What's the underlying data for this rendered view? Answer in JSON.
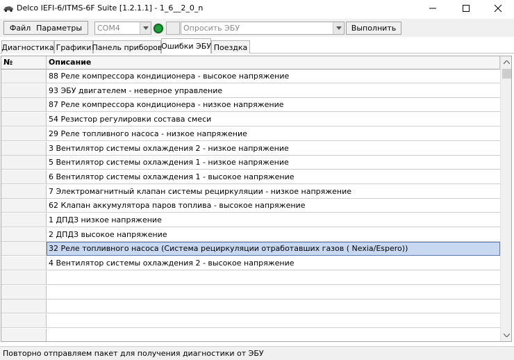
{
  "window": {
    "title": "Delco IEFI-6/ITMS-6F Suite [1.2.1.1] - 1_6__2_0_n",
    "controls": {
      "minimize": "—",
      "maximize": "☐",
      "close": "✕"
    }
  },
  "toolbar": {
    "menu_file": "Файл",
    "menu_params": "Параметры",
    "port_value": "COM4",
    "request_value": "Опросить ЭБУ",
    "execute_label": "Выполнить",
    "status_led_color": "#1f9e3a"
  },
  "tabs": [
    {
      "label": "Диагностика",
      "active": false
    },
    {
      "label": "Графики",
      "active": false
    },
    {
      "label": "Панель приборов",
      "active": false
    },
    {
      "label": "Ошибки ЭБУ",
      "active": true
    },
    {
      "label": "Поездка",
      "active": false
    }
  ],
  "grid": {
    "columns": [
      "№",
      "Описание"
    ],
    "rows": [
      "88 Реле компрессора кондиционера - высокое напряжение",
      "93 ЭБУ двигателем - неверное управление",
      "87 Реле компрессора кондиционера - низкое напряжение",
      "54 Резистор регулировки состава смеси",
      "29 Реле топливного насоса - низкое напряжение",
      "3 Вентилятор системы охлаждения 2 - низкое напряжение",
      "5 Вентилятор системы охлаждения 1 - низкое напряжение",
      "6 Вентилятор системы охлаждения 1 - высокое напряжение",
      "7 Электромагнитный клапан системы рециркуляции - низкое напряжение",
      "62 Клапан аккумулятора паров топлива - высокое напряжение",
      "1 ДПДЗ низкое напряжение",
      "2 ДПДЗ высокое напряжение",
      "32 Реле топливного насоса (Система рециркуляции отработавших газов ( Nexia/Espero))",
      "4 Вентилятор системы охлаждения 2 - высокое напряжение",
      "",
      "",
      "",
      "",
      ""
    ],
    "selected_row": 12,
    "selection_color": "#c8d8f0"
  },
  "statusbar": {
    "text": "Повторно отправляем пакет для получения диагностики от ЭБУ"
  }
}
